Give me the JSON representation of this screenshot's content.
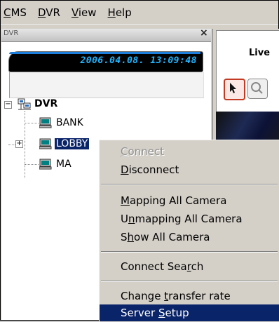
{
  "menubar": {
    "items": [
      {
        "mnemonic": "C",
        "rest": "MS"
      },
      {
        "mnemonic": "D",
        "rest": "VR"
      },
      {
        "mnemonic": "V",
        "rest": "iew"
      },
      {
        "mnemonic": "H",
        "rest": "elp"
      }
    ]
  },
  "dvr_panel": {
    "title": "DVR",
    "close": "×",
    "clock": "2006.04.08. 13:09:48",
    "tree": {
      "root": "DVR",
      "root_expander": "−",
      "nodes": [
        {
          "label": "BANK"
        },
        {
          "label": "LOBBY",
          "expander": "+"
        },
        {
          "label": "MA"
        }
      ]
    }
  },
  "right_panel": {
    "tab_label": "Live"
  },
  "context_menu": {
    "items": [
      {
        "pre": "",
        "mn": "C",
        "post": "onnect",
        "disabled": true
      },
      {
        "pre": "",
        "mn": "D",
        "post": "isconnect"
      },
      {
        "pre": "",
        "mn": "M",
        "post": "apping All Camera"
      },
      {
        "pre": "U",
        "mn": "n",
        "post": "mapping All Camera"
      },
      {
        "pre": "S",
        "mn": "h",
        "post": "ow All Camera"
      },
      {
        "pre": "Connect Sea",
        "mn": "r",
        "post": "ch"
      },
      {
        "pre": "Change ",
        "mn": "t",
        "post": "ransfer rate"
      },
      {
        "pre": "Server ",
        "mn": "S",
        "post": "etup",
        "highlight": true
      }
    ]
  },
  "colors": {
    "selection": "#0a246a",
    "lcd_text": "#20b6ff",
    "tool_active": "#c23a22"
  }
}
